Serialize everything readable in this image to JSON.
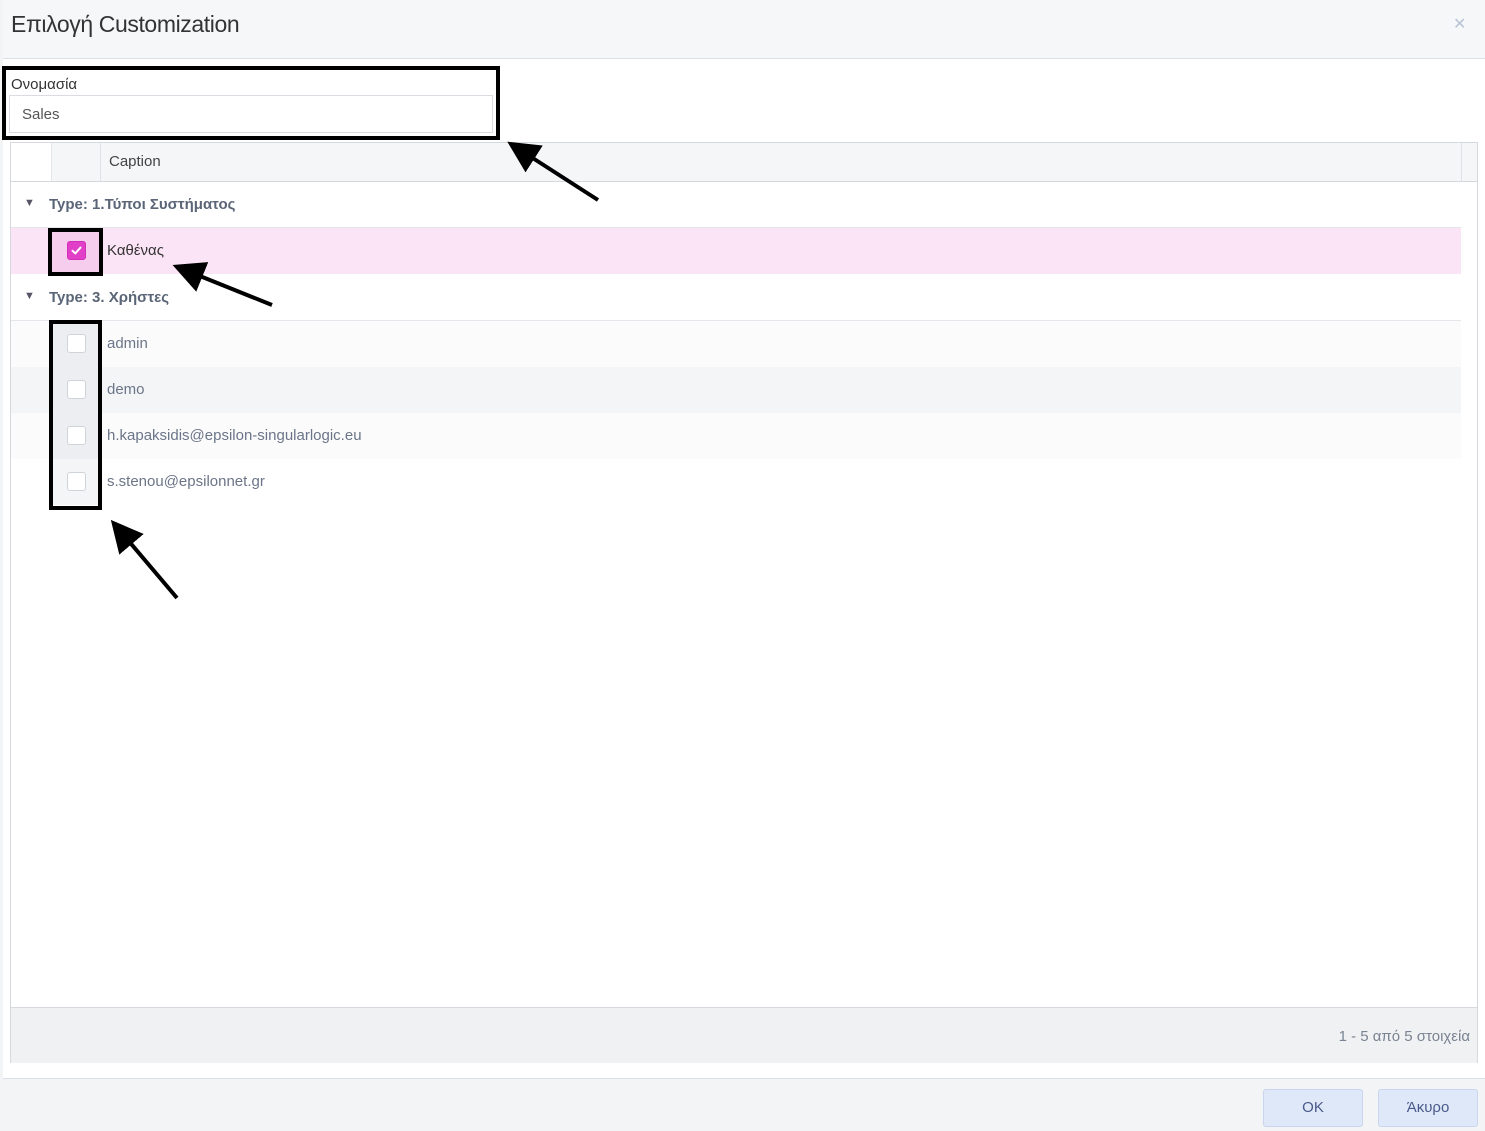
{
  "dialog": {
    "title": "Επιλογή Customization",
    "close_icon": "close-icon"
  },
  "name_field": {
    "label": "Ονομασία",
    "value": "Sales"
  },
  "grid": {
    "columns": [
      "",
      "",
      "Caption"
    ],
    "groups": [
      {
        "label": "Type: 1.Τύποι Συστήματος",
        "rows": [
          {
            "caption": "Καθένας",
            "checked": true
          }
        ]
      },
      {
        "label": "Type: 3. Χρήστες",
        "rows": [
          {
            "caption": "admin",
            "checked": false
          },
          {
            "caption": "demo",
            "checked": false
          },
          {
            "caption": "h.kapaksidis@epsilon-singularlogic.eu",
            "checked": false
          },
          {
            "caption": "s.stenou@epsilonnet.gr",
            "checked": false
          }
        ]
      }
    ],
    "pager_info": "1 - 5 από 5 στοιχεία"
  },
  "buttons": {
    "ok": "OK",
    "cancel": "Άκυρο"
  },
  "colors": {
    "accent": "#e23fc8",
    "selected_row": "#fbe4f6",
    "button_bg": "#dfe8f8"
  }
}
